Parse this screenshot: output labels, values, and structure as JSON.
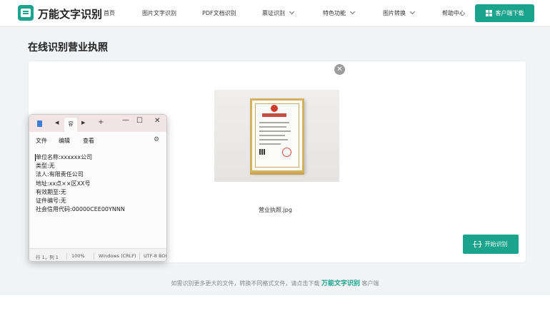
{
  "header": {
    "brand": "万能文字识别",
    "nav": [
      {
        "label": "首页",
        "has_dropdown": false
      },
      {
        "label": "图片文字识别",
        "has_dropdown": false
      },
      {
        "label": "PDF文档识别",
        "has_dropdown": false
      },
      {
        "label": "票证识别",
        "has_dropdown": true
      },
      {
        "label": "特色功能",
        "has_dropdown": true
      },
      {
        "label": "图片转换",
        "has_dropdown": true
      },
      {
        "label": "帮助中心",
        "has_dropdown": false
      }
    ],
    "download_button": "客户端下载",
    "accent_color": "#1aa38d"
  },
  "page_title": "在线识别营业执照",
  "panel": {
    "file_name": "营业执照.jpg",
    "remove_icon": "close-circle-icon",
    "start_button": "开始识别"
  },
  "footer": {
    "hint_prefix": "如需识别更多更大的文件，转换不同格式文件，请点击下载",
    "hint_brand": "万能文字识别",
    "hint_suffix": "客户端"
  },
  "notepad": {
    "tab_label": "容",
    "menu": [
      "文件",
      "编辑",
      "查看"
    ],
    "lines": [
      "单位名称:xxxxxx公司",
      "类型:无",
      "法人:有限责任公司",
      "地址:xx点××区XX号",
      "有效期至:无",
      "证件编号:无",
      "社会信用代码:00000CEE00YNNN"
    ],
    "status": {
      "position": "行 1，列 1",
      "zoom": "100%",
      "line_ending": "Windows (CRLF)",
      "encoding": "UTF-8 BOI"
    }
  }
}
